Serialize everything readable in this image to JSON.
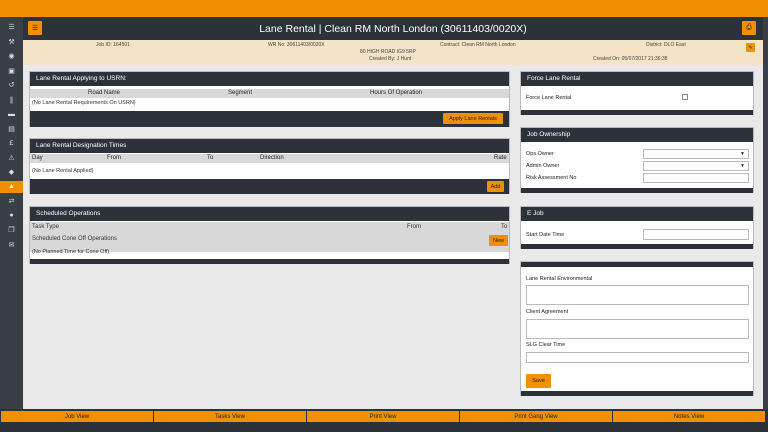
{
  "header": {
    "title": "Lane Rental | Clean RM North London (30611403/0020X)",
    "menu_icon": "hamburger-icon",
    "print_icon": "printer-icon"
  },
  "info": {
    "job_id": "Job ID: 164501",
    "wr_no": "WR No: 30611403/0020X",
    "contract": "Contract: Clean RM North London",
    "district": "District: DLO East",
    "address": "80 HIGH ROAD IG9 5RP",
    "created_by": "Created By: J Hunt",
    "created_on": "Created On: 05/07/2017 21:36:38"
  },
  "sidebar": {
    "icons": [
      "list-icon",
      "wrench-icon",
      "map-pin-icon",
      "camera-icon",
      "history-icon",
      "paperclip-icon",
      "truck-icon",
      "book-icon",
      "pound-icon",
      "warning-icon",
      "tag-icon",
      "cone-icon",
      "swap-icon",
      "user-icon",
      "copy-icon",
      "mail-icon"
    ],
    "active_index": 11
  },
  "lane_rental_usrn": {
    "title": "Lane Rental Applying to USRN:",
    "col_road": "Road Name",
    "col_segment": "Segment",
    "col_hours": "Hours Of Operation",
    "empty": "(No Lane Rental Requirements On USRN)",
    "button": "Apply Lane Rentals"
  },
  "designation": {
    "title": "Lane Rental Designation Times",
    "col_day": "Day",
    "col_from": "From",
    "col_to": "To",
    "col_direction": "Direction",
    "col_rate": "Rate",
    "empty": "(No Lane Rental Applied)",
    "button": "Add"
  },
  "scheduled": {
    "title": "Scheduled Operations",
    "col_task": "Task Type",
    "col_from": "From",
    "col_to": "To",
    "cone_off": "Scheduled Cone Off Operations",
    "button": "New",
    "empty": "(No Planned Time for Cone Off)"
  },
  "force": {
    "title": "Force Lane Rental",
    "label": "Force Lane Rental",
    "checked": false
  },
  "ownership": {
    "title": "Job Ownership",
    "ops_owner": "Ops Owner",
    "admin_owner": "Admin Owner",
    "risk": "Risk Assessment No",
    "ops_value": "",
    "admin_value": "",
    "risk_value": ""
  },
  "ejob": {
    "title": "E Job",
    "start_date": "Start Date Time",
    "start_value": ""
  },
  "notes": {
    "environmental": "Lane Rental Environmental",
    "client": "Client Agreement",
    "slg": "SLG Clear Time",
    "save": "Save"
  },
  "bottom_tabs": [
    "Job View",
    "Tasks View",
    "Print View",
    "Print Gang View",
    "Notes View"
  ],
  "colors": {
    "accent": "#f09000",
    "dark": "#2d323a",
    "info_bg": "#f5e3c8"
  }
}
